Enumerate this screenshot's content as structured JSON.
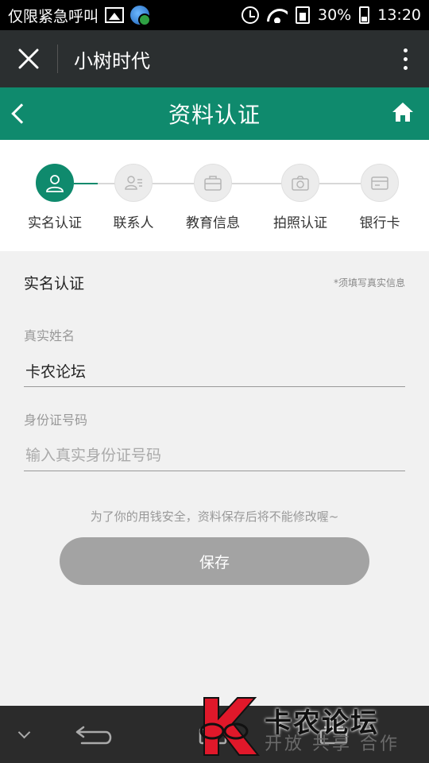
{
  "status_bar": {
    "notice": "仅限紧急呼叫",
    "battery": "30%",
    "time": "13:20",
    "icons": [
      "image-icon",
      "globe-icon",
      "alarm-icon",
      "wifi-icon",
      "sim-icon",
      "battery-icon"
    ]
  },
  "wechat_bar": {
    "title": "小树时代",
    "close_icon": "close-icon",
    "more_icon": "more-vertical-icon"
  },
  "header": {
    "title": "资料认证",
    "accent_color": "#0f8a6d"
  },
  "steps": [
    {
      "label": "实名认证",
      "icon": "user-icon",
      "active": true
    },
    {
      "label": "联系人",
      "icon": "contact-card-icon",
      "active": false
    },
    {
      "label": "教育信息",
      "icon": "briefcase-icon",
      "active": false
    },
    {
      "label": "拍照认证",
      "icon": "camera-icon",
      "active": false
    },
    {
      "label": "银行卡",
      "icon": "bank-card-icon",
      "active": false
    }
  ],
  "form": {
    "section_title": "实名认证",
    "note": "*须填写真实信息",
    "name_label": "真实姓名",
    "name_value": "卡农论坛",
    "id_label": "身份证号码",
    "id_placeholder": "输入真实身份证号码",
    "id_value": "",
    "safety_note": "为了你的用钱安全，资料保存后将不能修改喔~",
    "save_label": "保存"
  },
  "watermark": {
    "text": "卡农论坛",
    "subtext": "开放 共享 合作"
  }
}
